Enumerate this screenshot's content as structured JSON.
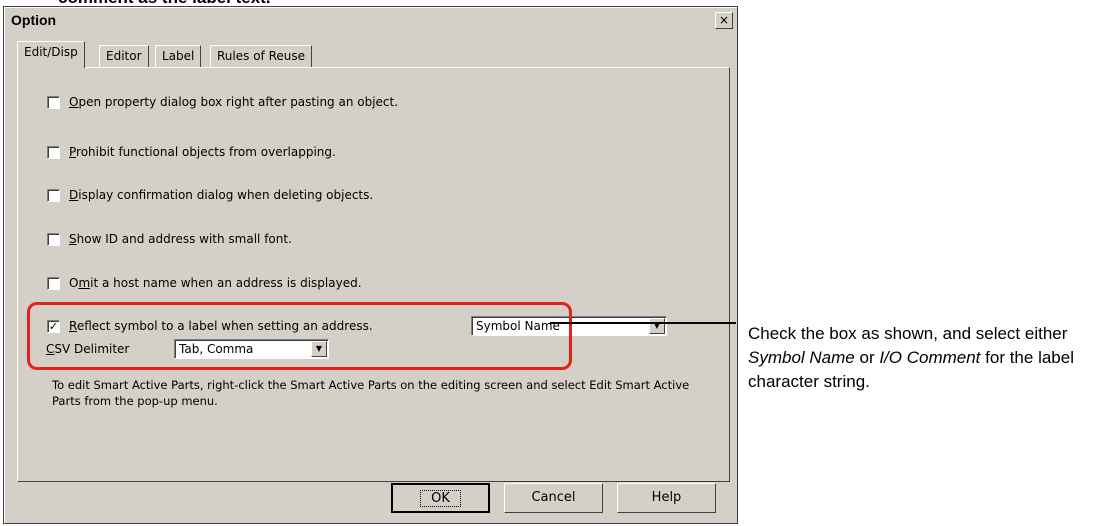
{
  "top_text": "comment as the label text.",
  "window": {
    "title": "Option",
    "close_label": "×"
  },
  "tabs": [
    {
      "label": "Edit/Disp",
      "active": true
    },
    {
      "label": "Editor",
      "active": false
    },
    {
      "label": "Label",
      "active": false
    },
    {
      "label": "Rules of Reuse",
      "active": false
    }
  ],
  "options": [
    {
      "key": "O",
      "rest": "pen property dialog box right after pasting an object.",
      "checked": false
    },
    {
      "key": "P",
      "rest": "rohibit functional objects from overlapping.",
      "checked": false
    },
    {
      "key": "D",
      "rest": "isplay confirmation dialog when deleting objects.",
      "checked": false
    },
    {
      "key": "S",
      "rest": "how ID and address with small font.",
      "checked": false
    },
    {
      "pre": "O",
      "key": "m",
      "rest": "it a host name when an address is displayed.",
      "checked": false
    },
    {
      "key": "R",
      "rest": "eflect symbol to a label when setting an address.",
      "checked": true
    }
  ],
  "checkmark": "✓",
  "label_source_select": {
    "value": "Symbol Name"
  },
  "csv": {
    "key": "C",
    "rest": "SV Delimiter",
    "value": "Tab, Comma"
  },
  "info_text": "To edit Smart Active Parts, right-click the Smart Active Parts on the editing screen and select Edit Smart Active Parts from the pop-up menu.",
  "buttons": {
    "ok": "OK",
    "cancel": "Cancel",
    "help": "Help"
  },
  "callout": {
    "part1": "Check the box as shown, and select either ",
    "italic1": "Symbol Name",
    "part2": " or ",
    "italic2": "I/O Comment",
    "part3": " for the label character string."
  },
  "colors": {
    "dialog_bg": "#d4d0c8",
    "highlight": "#e2231a"
  }
}
